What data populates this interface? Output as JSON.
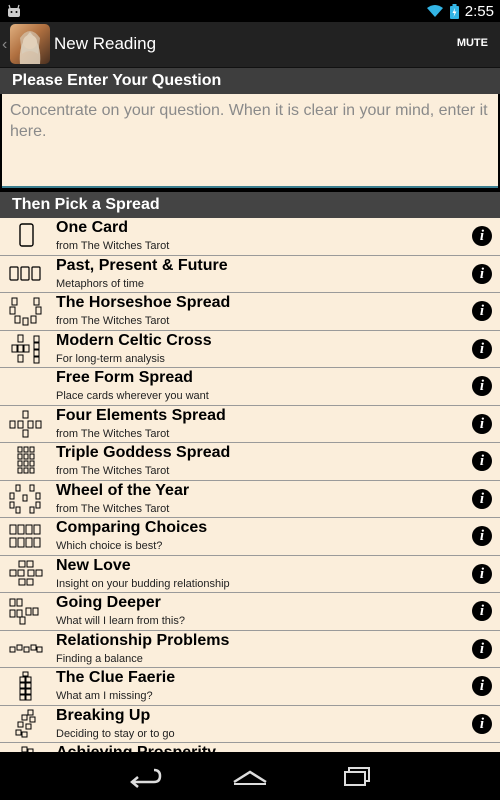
{
  "status_bar": {
    "time": "2:55"
  },
  "action_bar": {
    "title": "New Reading",
    "mute_label": "MUTE"
  },
  "question": {
    "header": "Please Enter Your Question",
    "placeholder": "Concentrate on your question. When it is clear in your mind, enter it here."
  },
  "spread_section": {
    "header": "Then Pick a Spread"
  },
  "spreads": [
    {
      "name": "One Card",
      "desc": "from The Witches Tarot"
    },
    {
      "name": "Past, Present & Future",
      "desc": "Metaphors of time"
    },
    {
      "name": "The Horseshoe Spread",
      "desc": "from The Witches Tarot"
    },
    {
      "name": "Modern Celtic Cross",
      "desc": "For long-term analysis"
    },
    {
      "name": "Free Form Spread",
      "desc": "Place cards wherever you want"
    },
    {
      "name": "Four Elements Spread",
      "desc": "from The Witches Tarot"
    },
    {
      "name": "Triple Goddess Spread",
      "desc": "from The Witches Tarot"
    },
    {
      "name": "Wheel of the Year",
      "desc": "from The Witches Tarot"
    },
    {
      "name": "Comparing Choices",
      "desc": "Which choice is best?"
    },
    {
      "name": "New Love",
      "desc": "Insight on your budding relationship"
    },
    {
      "name": "Going Deeper",
      "desc": "What will I learn from this?"
    },
    {
      "name": "Relationship Problems",
      "desc": "Finding a balance"
    },
    {
      "name": "The Clue Faerie",
      "desc": "What am I missing?"
    },
    {
      "name": "Breaking Up",
      "desc": "Deciding to stay or to go"
    },
    {
      "name": "Achieving Prosperity",
      "desc": ""
    }
  ],
  "info_glyph": "i",
  "colors": {
    "list_background": "#fbeedb",
    "section_header": "#444444",
    "input_underline": "#3b7e8f"
  }
}
